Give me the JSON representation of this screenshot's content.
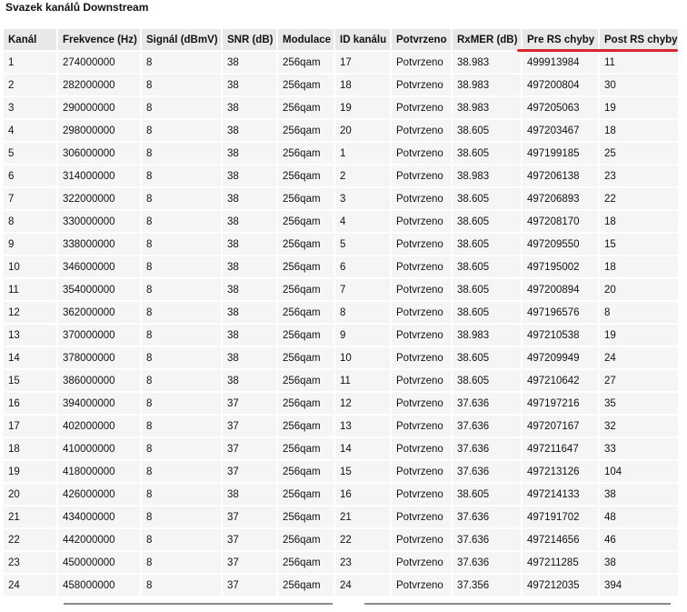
{
  "page": {
    "title": "Svazek kanálů Downstream"
  },
  "table": {
    "headers": [
      "Kanál",
      "Frekvence (Hz)",
      "Signál (dBmV)",
      "SNR (dB)",
      "Modulace",
      "ID kanálu",
      "Potvrzeno",
      "RxMER (dB)",
      "Pre RS chyby",
      "Post RS chyby"
    ],
    "rows": [
      [
        "1",
        "274000000",
        "8",
        "38",
        "256qam",
        "17",
        "Potvrzeno",
        "38.983",
        "499913984",
        "11"
      ],
      [
        "2",
        "282000000",
        "8",
        "38",
        "256qam",
        "18",
        "Potvrzeno",
        "38.983",
        "497200804",
        "30"
      ],
      [
        "3",
        "290000000",
        "8",
        "38",
        "256qam",
        "19",
        "Potvrzeno",
        "38.983",
        "497205063",
        "19"
      ],
      [
        "4",
        "298000000",
        "8",
        "38",
        "256qam",
        "20",
        "Potvrzeno",
        "38.605",
        "497203467",
        "18"
      ],
      [
        "5",
        "306000000",
        "8",
        "38",
        "256qam",
        "1",
        "Potvrzeno",
        "38.605",
        "497199185",
        "25"
      ],
      [
        "6",
        "314000000",
        "8",
        "38",
        "256qam",
        "2",
        "Potvrzeno",
        "38.983",
        "497206138",
        "23"
      ],
      [
        "7",
        "322000000",
        "8",
        "38",
        "256qam",
        "3",
        "Potvrzeno",
        "38.605",
        "497206893",
        "22"
      ],
      [
        "8",
        "330000000",
        "8",
        "38",
        "256qam",
        "4",
        "Potvrzeno",
        "38.605",
        "497208170",
        "18"
      ],
      [
        "9",
        "338000000",
        "8",
        "38",
        "256qam",
        "5",
        "Potvrzeno",
        "38.605",
        "497209550",
        "15"
      ],
      [
        "10",
        "346000000",
        "8",
        "38",
        "256qam",
        "6",
        "Potvrzeno",
        "38.605",
        "497195002",
        "18"
      ],
      [
        "11",
        "354000000",
        "8",
        "38",
        "256qam",
        "7",
        "Potvrzeno",
        "38.605",
        "497200894",
        "20"
      ],
      [
        "12",
        "362000000",
        "8",
        "38",
        "256qam",
        "8",
        "Potvrzeno",
        "38.605",
        "497196576",
        "8"
      ],
      [
        "13",
        "370000000",
        "8",
        "38",
        "256qam",
        "9",
        "Potvrzeno",
        "38.983",
        "497210538",
        "19"
      ],
      [
        "14",
        "378000000",
        "8",
        "38",
        "256qam",
        "10",
        "Potvrzeno",
        "38.605",
        "497209949",
        "24"
      ],
      [
        "15",
        "386000000",
        "8",
        "38",
        "256qam",
        "11",
        "Potvrzeno",
        "38.605",
        "497210642",
        "27"
      ],
      [
        "16",
        "394000000",
        "8",
        "37",
        "256qam",
        "12",
        "Potvrzeno",
        "37.636",
        "497197216",
        "35"
      ],
      [
        "17",
        "402000000",
        "8",
        "37",
        "256qam",
        "13",
        "Potvrzeno",
        "37.636",
        "497207167",
        "32"
      ],
      [
        "18",
        "410000000",
        "8",
        "37",
        "256qam",
        "14",
        "Potvrzeno",
        "37.636",
        "497211647",
        "33"
      ],
      [
        "19",
        "418000000",
        "8",
        "37",
        "256qam",
        "15",
        "Potvrzeno",
        "37.636",
        "497213126",
        "104"
      ],
      [
        "20",
        "426000000",
        "8",
        "38",
        "256qam",
        "16",
        "Potvrzeno",
        "38.605",
        "497214133",
        "38"
      ],
      [
        "21",
        "434000000",
        "8",
        "37",
        "256qam",
        "21",
        "Potvrzeno",
        "37.636",
        "497191702",
        "48"
      ],
      [
        "22",
        "442000000",
        "8",
        "37",
        "256qam",
        "22",
        "Potvrzeno",
        "37.636",
        "497214656",
        "46"
      ],
      [
        "23",
        "450000000",
        "8",
        "37",
        "256qam",
        "23",
        "Potvrzeno",
        "37.636",
        "497211285",
        "38"
      ],
      [
        "24",
        "458000000",
        "8",
        "37",
        "256qam",
        "24",
        "Potvrzeno",
        "37.356",
        "497212035",
        "394"
      ]
    ]
  },
  "colors": {
    "header_bg": "#e8e8e8",
    "cell_bg": "#f5f5f5",
    "highlight_underline": "#d9252c"
  }
}
